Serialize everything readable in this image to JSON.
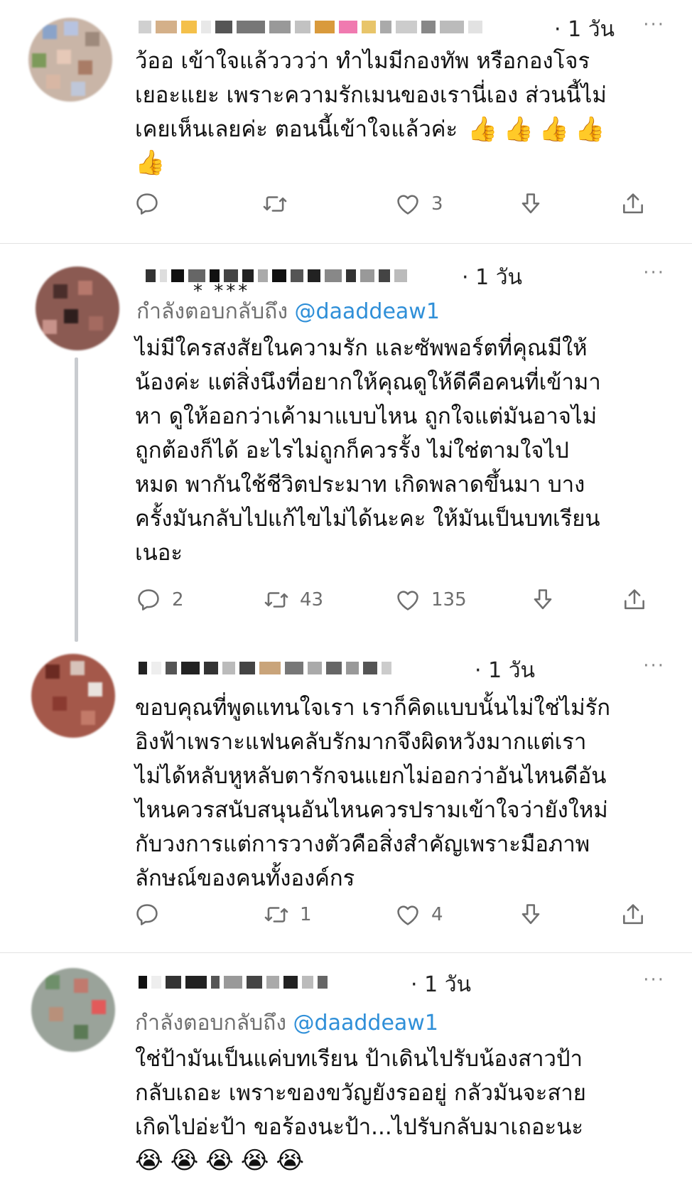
{
  "tweets": [
    {
      "time": "· 1 วัน",
      "more": "···",
      "replying_to": null,
      "lines": [
        "ว้ออ เข้าใจแล้วววว่า ทำไมมีกองทัพ   หรือกองโจร",
        "เยอะแยะ เพราะความรักเมนของเรานี่เอง ส่วนนี้ไม่",
        "เคยเห็นเลยค่ะ  ตอนนี้เข้าใจแล้วค่ะ"
      ],
      "emoji": [
        "👍",
        "👍",
        "👍",
        "👍",
        "👍"
      ],
      "replies": "",
      "retweets": "",
      "likes": "3"
    },
    {
      "time": "· 1 วัน",
      "more": "···",
      "name_fragment": "*      ***",
      "replying_label": "กำลังตอบกลับถึง",
      "replying_handle": "@daaddeaw1",
      "lines": [
        "ไม่มีใครสงสัยในความรัก และซัพพอร์ตที่คุณมีให้",
        "น้องค่ะ แต่สิ่งนึงที่อยากให้คุณดูให้ดีคือคนที่เข้ามา",
        "หา ดูให้ออกว่าเค้ามาแบบไหน ถูกใจแต่มันอาจไม่",
        "ถูกต้องก็ได้ อะไรไม่ถูกก็ควรรั้ง ไม่ใช่ตามใจไป",
        "หมด พากันใช้ชีวิตประมาท เกิดพลาดขึ้นมา บาง",
        "ครั้งมันกลับไปแก้ไขไม่ได้นะคะ ให้มันเป็นบทเรียน",
        "เนอะ"
      ],
      "replies": "2",
      "retweets": "43",
      "likes": "135"
    },
    {
      "time": "· 1 วัน",
      "more": "···",
      "lines": [
        "ขอบคุณที่พูดแทนใจเรา เราก็คิดแบบนั้นไม่ใช่ไม่รัก",
        "อิงฟ้าเพราะแฟนคลับรักมากจึงผิดหวังมากแต่เรา",
        "ไม่ได้หลับหูหลับตารักจนแยกไม่ออกว่าอันไหนดีอัน",
        "ไหนควรสนับสนุนอันไหนควรปรามเข้าใจว่ายังใหม่",
        "กับวงการแต่การวางตัวคือสิ่งสำคัญเพราะมือภาพ",
        "ลักษณ์ของคนทั้งองค์กร"
      ],
      "replies": "",
      "retweets": "1",
      "likes": "4"
    },
    {
      "time": "· 1 วัน",
      "more": "···",
      "replying_label": "กำลังตอบกลับถึง",
      "replying_handle": "@daaddeaw1",
      "lines": [
        "ใช่ป้ามันเป็นแค่บทเรียน ป้าเดินไปรับน้องสาวป้า",
        "กลับเถอะ เพราะของขวัญยังรออยู่ กลัวมันจะสาย",
        "เกิดไปอ่ะป้า ขอร้องนะป้า...ไปรับกลับมาเถอะนะ"
      ],
      "emoji": [
        "😭",
        "😭",
        "😭",
        "😭",
        "😭"
      ]
    }
  ],
  "colors": {
    "link": "#2f8fd8",
    "muted": "#6e6e6e",
    "thread": "#c9ccd0"
  },
  "icons": [
    "reply-icon",
    "retweet-icon",
    "like-icon",
    "download-icon",
    "share-icon"
  ]
}
